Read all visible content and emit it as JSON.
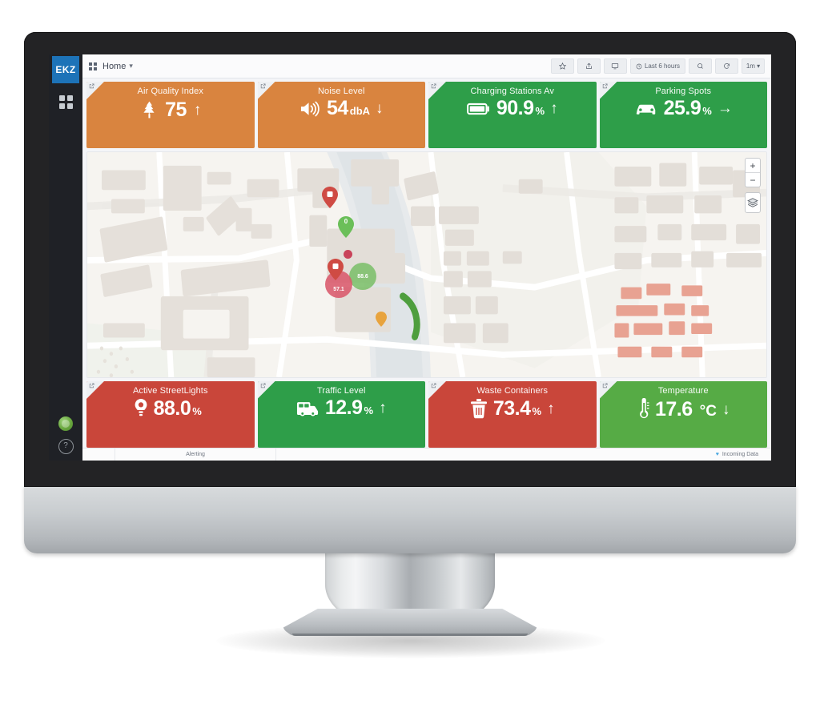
{
  "brand": {
    "logo_text": "EKZ"
  },
  "navbar": {
    "menu_icon": "grid-icon",
    "title": "Home",
    "caret": "▾",
    "actions": [
      {
        "name": "star-button",
        "icon": "star-icon",
        "label": ""
      },
      {
        "name": "share-button",
        "icon": "share-icon",
        "label": ""
      },
      {
        "name": "tv-mode-button",
        "icon": "monitor-icon",
        "label": ""
      },
      {
        "name": "time-range-picker",
        "icon": "clock-icon",
        "label": "Last 6 hours"
      },
      {
        "name": "zoom-out-time-button",
        "icon": "search-icon",
        "label": ""
      },
      {
        "name": "refresh-button",
        "icon": "refresh-icon",
        "label": ""
      },
      {
        "name": "refresh-interval-picker",
        "icon": "",
        "label": "1m ▾"
      }
    ]
  },
  "sidebar": {
    "dashboards_icon": "grid-icon",
    "avatar": "user-avatar",
    "help": "?"
  },
  "colors": {
    "orange": "#d9843f",
    "green": "#2e9e49",
    "green_light": "#56ab45",
    "red": "#c9463a",
    "blue": "#1d73b8"
  },
  "stats_top": [
    {
      "title": "Air Quality Index",
      "icon": "tree-icon",
      "value": "75",
      "unit": "",
      "arrow": "↑",
      "color": "#d9843f"
    },
    {
      "title": "Noise Level",
      "icon": "volume-icon",
      "value": "54",
      "unit": "dbA",
      "arrow": "↓",
      "color": "#d9843f"
    },
    {
      "title": "Charging Stations Av",
      "icon": "battery-icon",
      "value": "90.9",
      "unit": "%",
      "arrow": "↑",
      "color": "#2e9e49"
    },
    {
      "title": "Parking Spots",
      "icon": "car-icon",
      "value": "25.9",
      "unit": "%",
      "arrow": "→",
      "color": "#2e9e49"
    }
  ],
  "stats_bottom": [
    {
      "title": "Active StreetLights",
      "icon": "lightbulb-icon",
      "value": "88.0",
      "unit": "%",
      "arrow": "",
      "color": "#c9463a"
    },
    {
      "title": "Traffic Level",
      "icon": "truck-icon",
      "value": "12.9",
      "unit": "%",
      "arrow": "↑",
      "color": "#2e9e49"
    },
    {
      "title": "Waste Containers",
      "icon": "trash-icon",
      "value": "73.4",
      "unit": "%",
      "arrow": "↑",
      "color": "#c9463a"
    },
    {
      "title": "Temperature",
      "icon": "thermometer-icon",
      "value": "17.6",
      "unit": " °C",
      "arrow": "↓",
      "color": "#56ab45"
    }
  ],
  "map": {
    "zoom_in": "+",
    "zoom_out": "−",
    "layers_icon": "layers-icon",
    "markers": [
      {
        "name": "map-marker-red-top",
        "type": "pin",
        "color": "#cf4b44",
        "label": ""
      },
      {
        "name": "map-marker-green",
        "type": "pin",
        "color": "#6bbf59",
        "label": "0"
      },
      {
        "name": "map-marker-red-lower",
        "type": "pin",
        "color": "#cf4b44",
        "label": ""
      },
      {
        "name": "map-bubble-green",
        "type": "bubble",
        "color": "#7cbf6a",
        "label": "88.6"
      },
      {
        "name": "map-bubble-red",
        "type": "bubble",
        "color": "#d9596b",
        "label": "57.1"
      },
      {
        "name": "map-dot-red",
        "type": "dot",
        "color": "#c9435a",
        "label": ""
      }
    ]
  },
  "statusbar": {
    "alerting": "Alerting",
    "incoming_data": "Incoming Data",
    "incoming_icon": "heart-icon"
  }
}
